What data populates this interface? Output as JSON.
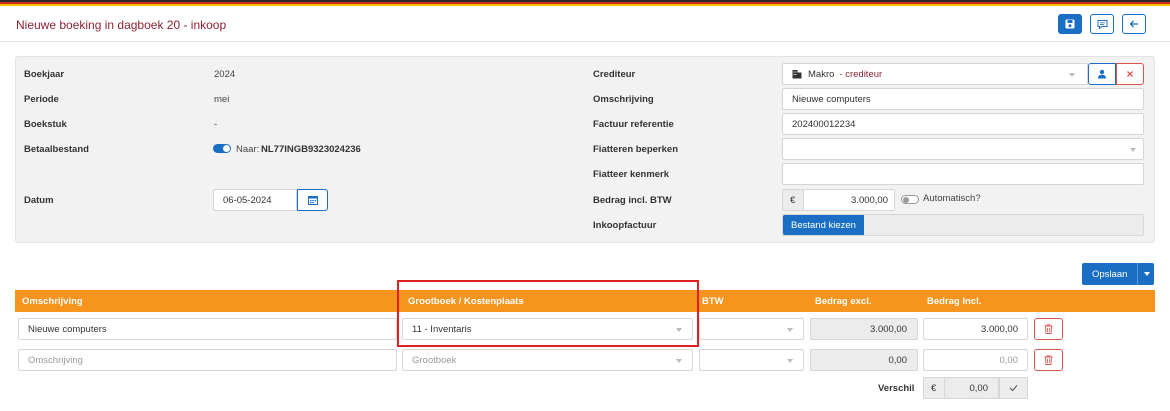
{
  "header": {
    "title": "Nieuwe boeking in dagboek 20 - inkoop"
  },
  "form": {
    "boekjaar": {
      "label": "Boekjaar",
      "value": "2024"
    },
    "periode": {
      "label": "Periode",
      "value": "mei"
    },
    "boekstuk": {
      "label": "Boekstuk",
      "value": "-"
    },
    "betaalbestand": {
      "label": "Betaalbestand",
      "prefix": "Naar:",
      "iban": "NL77INGB9323024236"
    },
    "datum": {
      "label": "Datum",
      "value": "06-05-2024"
    },
    "crediteur": {
      "label": "Crediteur",
      "name": "Makro",
      "suffix": "- crediteur"
    },
    "omschrijving": {
      "label": "Omschrijving",
      "value": "Nieuwe computers"
    },
    "factuur_referentie": {
      "label": "Factuur referentie",
      "value": "202400012234"
    },
    "fiatteren_beperken": {
      "label": "Fiatteren beperken",
      "value": ""
    },
    "fiatteer_kenmerk": {
      "label": "Fiatteer kenmerk",
      "value": ""
    },
    "bedrag": {
      "label": "Bedrag incl. BTW",
      "currency": "€",
      "value": "3.000,00",
      "automatisch": "Automatisch?"
    },
    "inkoopfactuur": {
      "label": "Inkoopfactuur",
      "button": "Bestand kiezen"
    }
  },
  "actions": {
    "save_label": "Opslaan"
  },
  "table": {
    "headers": [
      "Omschrijving",
      "Grootboek / Kostenplaats",
      "BTW",
      "Bedrag excl.",
      "Bedrag Incl."
    ],
    "rows": [
      {
        "omschrijving": "Nieuwe computers",
        "grootboek": "11 - Inventaris",
        "btw": "",
        "excl": "3.000,00",
        "incl": "3.000,00"
      },
      {
        "omschrijving": "",
        "grootboek": "",
        "btw": "",
        "excl": "0,00",
        "incl": "0,00"
      }
    ],
    "placeholders": {
      "omschrijving": "Omschrijving",
      "grootboek": "Grootboek",
      "incl": "0,00"
    },
    "verschil": {
      "label": "Verschil",
      "currency": "€",
      "value": "0,00"
    }
  },
  "colors": {
    "accent": "#1a6fc4",
    "table_header": "#f7941d",
    "title": "#8a2433",
    "danger": "#d9534f",
    "highlight": "#e0201e"
  }
}
